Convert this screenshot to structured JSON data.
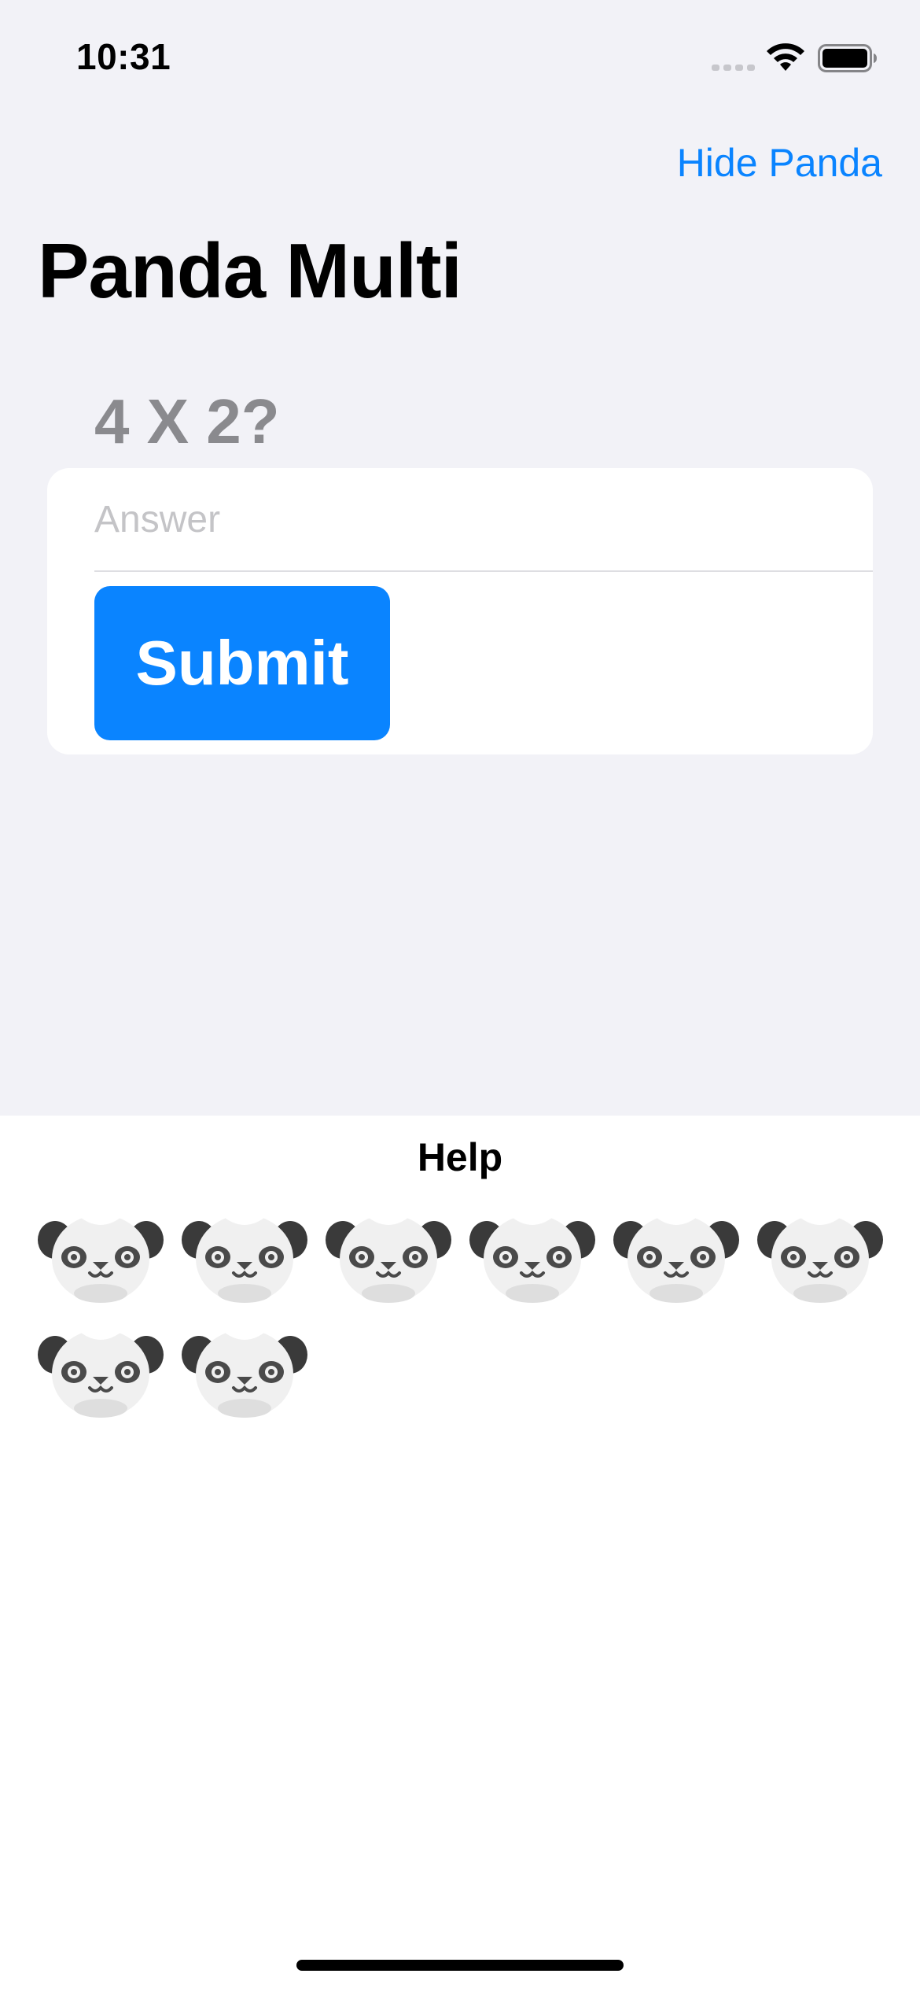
{
  "status_bar": {
    "time": "10:31",
    "icons": [
      "cellular-signal-icon",
      "wifi-icon",
      "battery-icon"
    ]
  },
  "nav": {
    "hide_panda_label": "Hide Panda",
    "title": "Panda Multi"
  },
  "quiz": {
    "question": "4 X 2?",
    "answer_placeholder": "Answer",
    "answer_value": "",
    "submit_label": "Submit"
  },
  "help": {
    "title": "Help",
    "panda_count": 8,
    "panda_icon": "panda-face-icon"
  },
  "colors": {
    "accent": "#0a84ff",
    "background": "#f2f2f7",
    "question_text": "#8a8a8e"
  }
}
